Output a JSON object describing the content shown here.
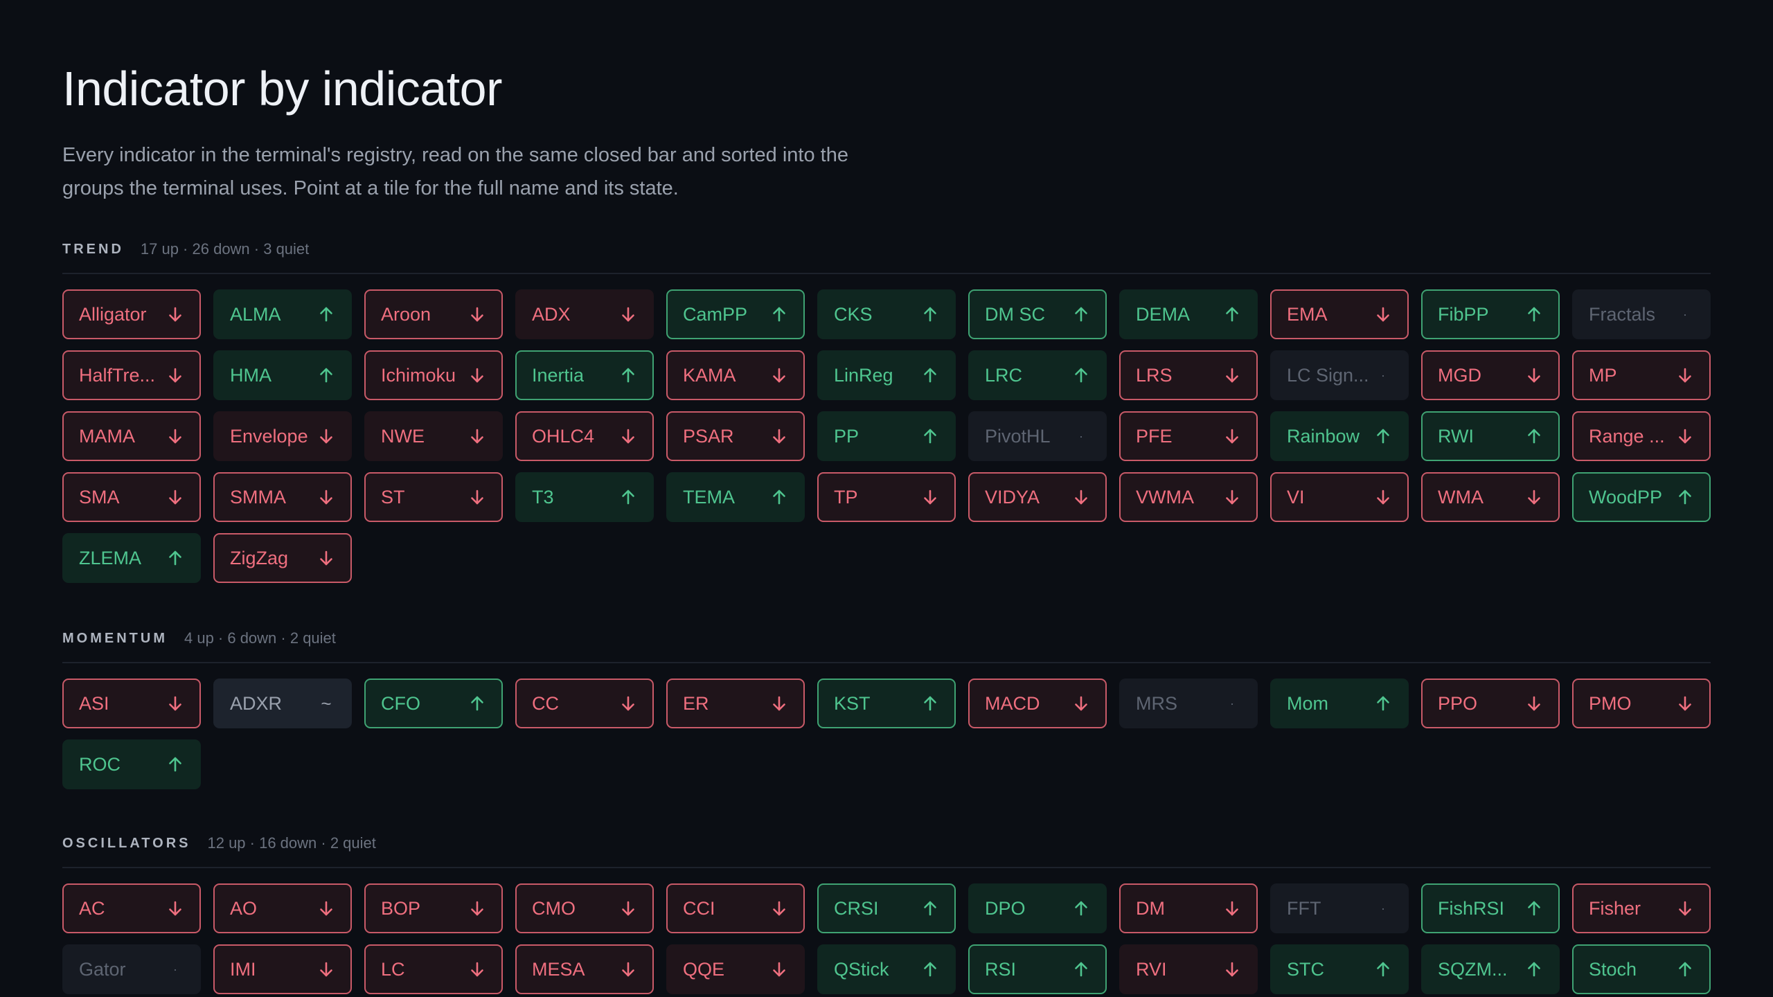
{
  "title": "Indicator by indicator",
  "subtitle_line1": "Every indicator in the terminal's registry, read on the same closed bar and sorted into the",
  "subtitle_line2": "groups the terminal uses. Point at a tile for the full name and its state.",
  "sections": [
    {
      "title": "TREND",
      "counts": "17 up · 26 down · 3 quiet",
      "tiles": [
        {
          "label": "Alligator",
          "state": "down",
          "bordered": true
        },
        {
          "label": "ALMA",
          "state": "up",
          "bordered": false
        },
        {
          "label": "Aroon",
          "state": "down",
          "bordered": true
        },
        {
          "label": "ADX",
          "state": "down",
          "bordered": false
        },
        {
          "label": "CamPP",
          "state": "up",
          "bordered": true
        },
        {
          "label": "CKS",
          "state": "up",
          "bordered": false
        },
        {
          "label": "DM SC",
          "state": "up",
          "bordered": true
        },
        {
          "label": "DEMA",
          "state": "up",
          "bordered": false
        },
        {
          "label": "EMA",
          "state": "down",
          "bordered": true
        },
        {
          "label": "FibPP",
          "state": "up",
          "bordered": true
        },
        {
          "label": "Fractals",
          "state": "quiet",
          "bordered": false
        },
        {
          "label": "HalfTre...",
          "state": "down",
          "bordered": true
        },
        {
          "label": "HMA",
          "state": "up",
          "bordered": false
        },
        {
          "label": "Ichimoku",
          "state": "down",
          "bordered": true
        },
        {
          "label": "Inertia",
          "state": "up",
          "bordered": true
        },
        {
          "label": "KAMA",
          "state": "down",
          "bordered": true
        },
        {
          "label": "LinReg",
          "state": "up",
          "bordered": false
        },
        {
          "label": "LRC",
          "state": "up",
          "bordered": false
        },
        {
          "label": "LRS",
          "state": "down",
          "bordered": true
        },
        {
          "label": "LC Sign...",
          "state": "quiet",
          "bordered": false
        },
        {
          "label": "MGD",
          "state": "down",
          "bordered": true
        },
        {
          "label": "MP",
          "state": "down",
          "bordered": true
        },
        {
          "label": "MAMA",
          "state": "down",
          "bordered": true
        },
        {
          "label": "Envelope",
          "state": "down",
          "bordered": false
        },
        {
          "label": "NWE",
          "state": "down",
          "bordered": false
        },
        {
          "label": "OHLC4",
          "state": "down",
          "bordered": true
        },
        {
          "label": "PSAR",
          "state": "down",
          "bordered": true
        },
        {
          "label": "PP",
          "state": "up",
          "bordered": false
        },
        {
          "label": "PivotHL",
          "state": "quiet",
          "bordered": false
        },
        {
          "label": "PFE",
          "state": "down",
          "bordered": true
        },
        {
          "label": "Rainbow",
          "state": "up",
          "bordered": false
        },
        {
          "label": "RWI",
          "state": "up",
          "bordered": true
        },
        {
          "label": "Range ...",
          "state": "down",
          "bordered": true
        },
        {
          "label": "SMA",
          "state": "down",
          "bordered": true
        },
        {
          "label": "SMMA",
          "state": "down",
          "bordered": true
        },
        {
          "label": "ST",
          "state": "down",
          "bordered": true
        },
        {
          "label": "T3",
          "state": "up",
          "bordered": false
        },
        {
          "label": "TEMA",
          "state": "up",
          "bordered": false
        },
        {
          "label": "TP",
          "state": "down",
          "bordered": true
        },
        {
          "label": "VIDYA",
          "state": "down",
          "bordered": true
        },
        {
          "label": "VWMA",
          "state": "down",
          "bordered": true
        },
        {
          "label": "VI",
          "state": "down",
          "bordered": true
        },
        {
          "label": "WMA",
          "state": "down",
          "bordered": true
        },
        {
          "label": "WoodPP",
          "state": "up",
          "bordered": true
        },
        {
          "label": "ZLEMA",
          "state": "up",
          "bordered": false
        },
        {
          "label": "ZigZag",
          "state": "down",
          "bordered": true
        }
      ]
    },
    {
      "title": "MOMENTUM",
      "counts": "4 up · 6 down · 2 quiet",
      "tiles": [
        {
          "label": "ASI",
          "state": "down",
          "bordered": true
        },
        {
          "label": "ADXR",
          "state": "neutral",
          "bordered": false
        },
        {
          "label": "CFO",
          "state": "up",
          "bordered": true
        },
        {
          "label": "CC",
          "state": "down",
          "bordered": true
        },
        {
          "label": "ER",
          "state": "down",
          "bordered": true
        },
        {
          "label": "KST",
          "state": "up",
          "bordered": true
        },
        {
          "label": "MACD",
          "state": "down",
          "bordered": true
        },
        {
          "label": "MRS",
          "state": "quiet",
          "bordered": false
        },
        {
          "label": "Mom",
          "state": "up",
          "bordered": false
        },
        {
          "label": "PPO",
          "state": "down",
          "bordered": true
        },
        {
          "label": "PMO",
          "state": "down",
          "bordered": true
        },
        {
          "label": "ROC",
          "state": "up",
          "bordered": false
        }
      ]
    },
    {
      "title": "OSCILLATORS",
      "counts": "12 up · 16 down · 2 quiet",
      "tiles": [
        {
          "label": "AC",
          "state": "down",
          "bordered": true
        },
        {
          "label": "AO",
          "state": "down",
          "bordered": true
        },
        {
          "label": "BOP",
          "state": "down",
          "bordered": true
        },
        {
          "label": "CMO",
          "state": "down",
          "bordered": true
        },
        {
          "label": "CCI",
          "state": "down",
          "bordered": true
        },
        {
          "label": "CRSI",
          "state": "up",
          "bordered": true
        },
        {
          "label": "DPO",
          "state": "up",
          "bordered": false
        },
        {
          "label": "DM",
          "state": "down",
          "bordered": true
        },
        {
          "label": "FFT",
          "state": "quiet",
          "bordered": false
        },
        {
          "label": "FishRSI",
          "state": "up",
          "bordered": true
        },
        {
          "label": "Fisher",
          "state": "down",
          "bordered": true
        },
        {
          "label": "Gator",
          "state": "quiet",
          "bordered": false
        },
        {
          "label": "IMI",
          "state": "down",
          "bordered": true
        },
        {
          "label": "LC",
          "state": "down",
          "bordered": true
        },
        {
          "label": "MESA",
          "state": "down",
          "bordered": true
        },
        {
          "label": "QQE",
          "state": "down",
          "bordered": false
        },
        {
          "label": "QStick",
          "state": "up",
          "bordered": false
        },
        {
          "label": "RSI",
          "state": "up",
          "bordered": true
        },
        {
          "label": "RVI",
          "state": "down",
          "bordered": false
        },
        {
          "label": "STC",
          "state": "up",
          "bordered": false
        },
        {
          "label": "SQZM...",
          "state": "up",
          "bordered": false
        },
        {
          "label": "Stoch",
          "state": "up",
          "bordered": true
        }
      ]
    }
  ],
  "icons": {
    "up": "arrow-up-icon",
    "down": "arrow-down-icon",
    "quiet": "dot-icon",
    "neutral": "tilde-icon"
  },
  "colors": {
    "background": "#0b0e14",
    "down_text": "#ef6f7f",
    "up_text": "#4fc58f",
    "quiet_text": "#5e6572"
  }
}
